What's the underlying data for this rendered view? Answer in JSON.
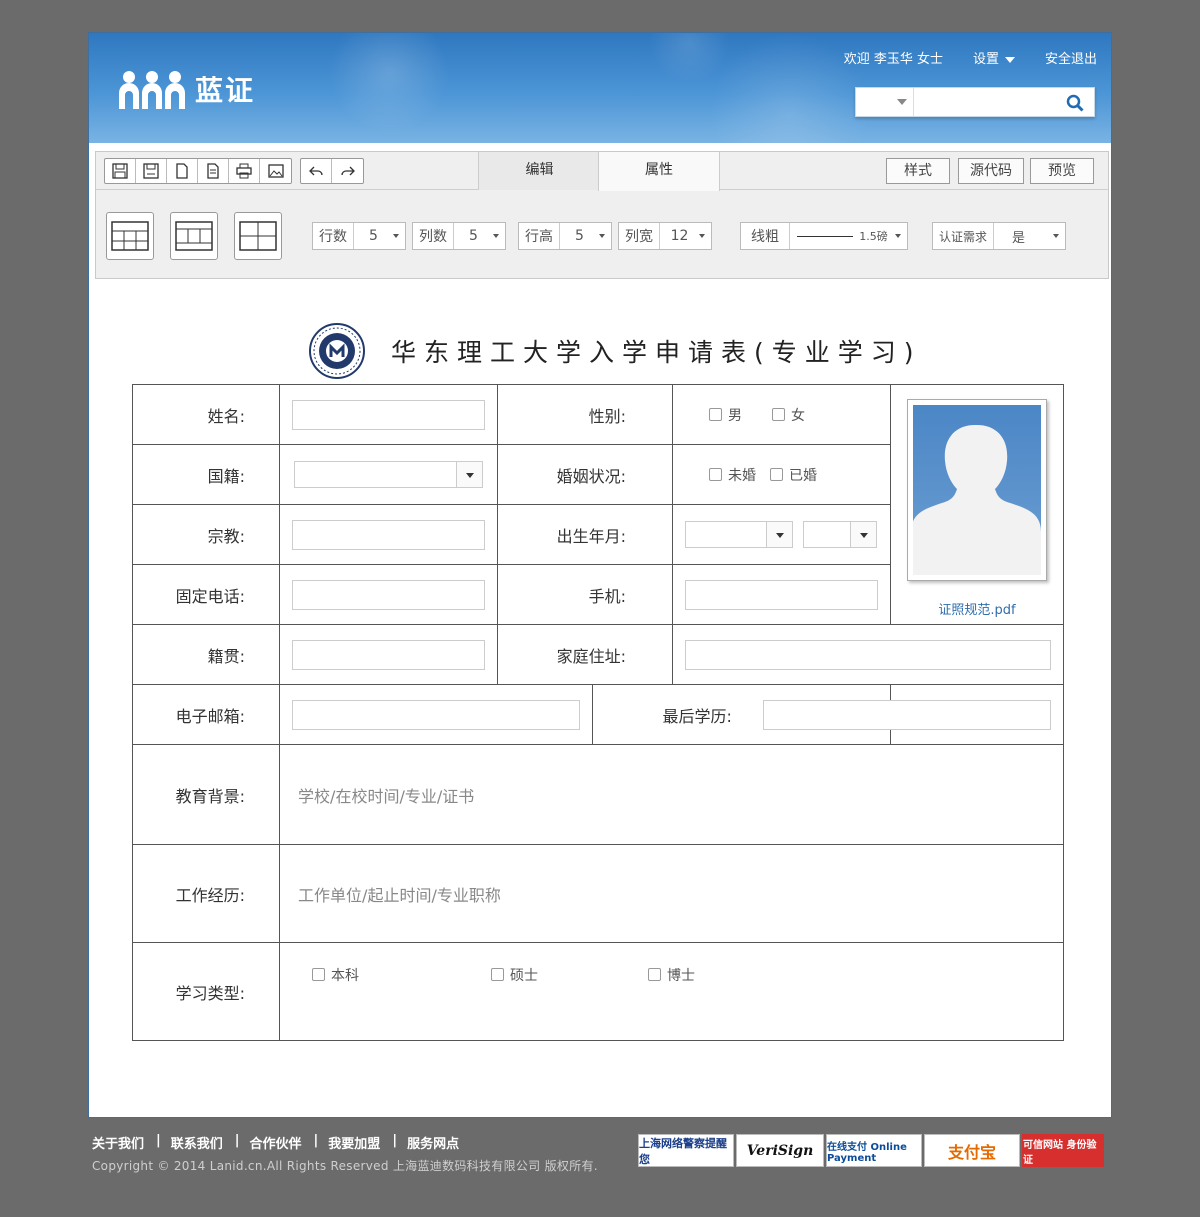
{
  "header": {
    "logo_text": "蓝证",
    "greeting": "欢迎 李玉华 女士",
    "settings_label": "设置",
    "logout_label": "安全退出",
    "search_value": ""
  },
  "toolbar": {
    "tabs": [
      "编辑",
      "属性"
    ],
    "right_buttons": [
      "样式",
      "源代码",
      "预览"
    ],
    "props": {
      "rows": {
        "label": "行数",
        "value": "5"
      },
      "cols": {
        "label": "列数",
        "value": "5"
      },
      "row_height": {
        "label": "行高",
        "value": "5"
      },
      "col_width": {
        "label": "列宽",
        "value": "12"
      },
      "line_weight": {
        "label": "线粗",
        "value": "1.5磅"
      },
      "auth": {
        "label": "认证需求",
        "value": "是"
      }
    }
  },
  "form": {
    "title": "华东理工大学入学申请表(专业学习)",
    "name_label": "姓名:",
    "gender_label": "性别:",
    "gender_options": [
      "男",
      "女"
    ],
    "nationality_label": "国籍:",
    "marital_label": "婚姻状况:",
    "marital_options": [
      "未婚",
      "已婚"
    ],
    "religion_label": "宗教:",
    "birth_label": "出生年月:",
    "phone_label": "固定电话:",
    "mobile_label": "手机:",
    "origin_label": "籍贯:",
    "address_label": "家庭住址:",
    "email_label": "电子邮箱:",
    "degree_label": "最后学历:",
    "education_label": "教育背景:",
    "education_placeholder": "学校/在校时间/专业/证书",
    "work_label": "工作经历:",
    "work_placeholder": "工作单位/起止时间/专业职称",
    "study_type_label": "学习类型:",
    "study_type_options": [
      "本科",
      "硕士",
      "博士"
    ],
    "photo_file": "证照规范.pdf"
  },
  "footer": {
    "links": [
      "关于我们",
      "联系我们",
      "合作伙伴",
      "我要加盟",
      "服务网点"
    ],
    "copyright": "Copyright © 2014 Lanid.cn.All Rights Reserved 上海蓝迪数码科技有限公司 版权所有.",
    "badges": [
      "上海网络警察提醒您",
      "VeriSign",
      "在线支付 Online Payment",
      "支付宝",
      "可信网站 身份验证"
    ]
  },
  "colors": {
    "header_blue": "#3a82c8",
    "link_blue": "#2f6eac",
    "page_bg": "#6b6b6b"
  }
}
